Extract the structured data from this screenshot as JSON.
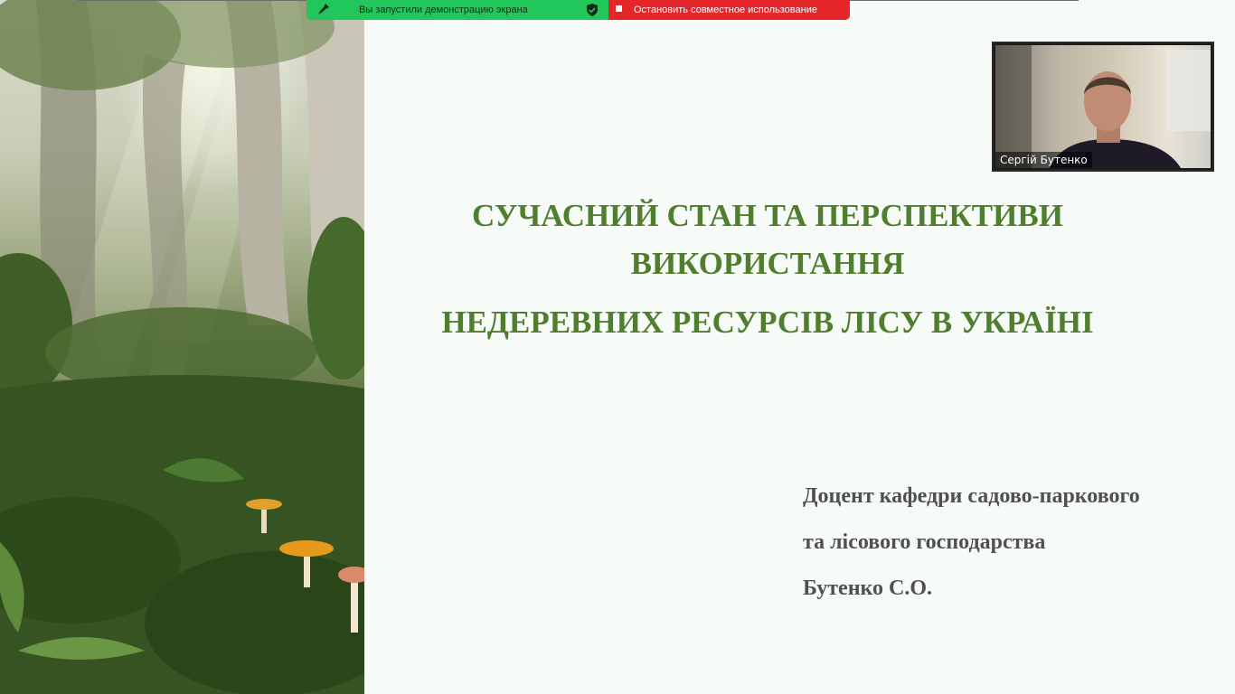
{
  "share_bar": {
    "status_text": "Вы запустили демонстрацию экрана",
    "stop_text": "Остановить совместное использование",
    "lead_icon": "pin-icon",
    "status_icon": "shield-check-icon",
    "stop_icon": "stop-square-icon",
    "status_color": "#21c75a",
    "stop_color": "#e5252a"
  },
  "video": {
    "participant_name": "Сергій Бутенко"
  },
  "slide": {
    "title_lines": [
      "СУЧАСНИЙ СТАН ТА ПЕРСПЕКТИВИ",
      "ВИКОРИСТАННЯ",
      "НЕДЕРЕВНИХ РЕСУРСІВ ЛІСУ В УКРАЇНІ"
    ],
    "author_lines": [
      "Доцент кафедри садово-паркового",
      "та лісового господарства",
      "Бутенко С.О."
    ],
    "title_color": "#4f7e2f",
    "author_color": "#505050"
  }
}
